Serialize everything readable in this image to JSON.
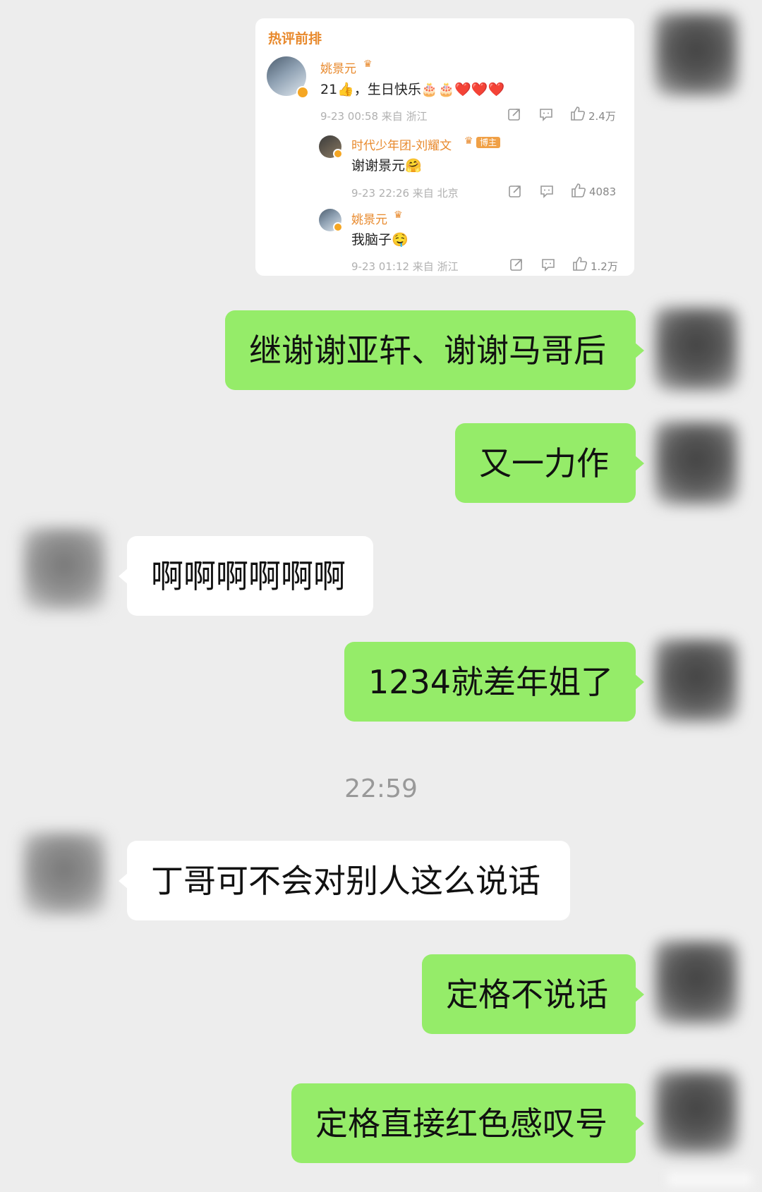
{
  "card": {
    "title": "热评前排",
    "main": {
      "name": "姚景元",
      "text": "21👍，生日快乐🎂🎂❤️❤️❤️",
      "meta": "9-23 00:58  来自 浙江",
      "likes": "2.4万"
    },
    "reply1": {
      "name": "时代少年团-刘耀文",
      "badge": "博主",
      "text": "谢谢景元🤗",
      "meta": "9-23 22:26  来自 北京",
      "likes": "4083"
    },
    "reply2": {
      "name": "姚景元",
      "text": "我脑子🤤",
      "meta": "9-23 01:12  来自 浙江",
      "likes": "1.2万"
    }
  },
  "messages": [
    {
      "text": "继谢谢亚轩、谢谢马哥后"
    },
    {
      "text": "又一力作"
    },
    {
      "text": "啊啊啊啊啊啊"
    },
    {
      "text": "1234就差年姐了"
    },
    {
      "text": "丁哥可不会对别人这么说话"
    },
    {
      "text": "定格不说话"
    },
    {
      "text": "定格直接红色感叹号"
    }
  ],
  "timestamp": "22:59",
  "colors": {
    "background": "#ededed",
    "outgoing_bubble": "#95ec69",
    "incoming_bubble": "#ffffff",
    "weibo_accent": "#e8892c"
  },
  "icons": {
    "share": "share-icon",
    "comment": "comment-icon",
    "like": "thumbs-up-icon",
    "crown": "crown-icon",
    "verified": "verified-icon"
  }
}
